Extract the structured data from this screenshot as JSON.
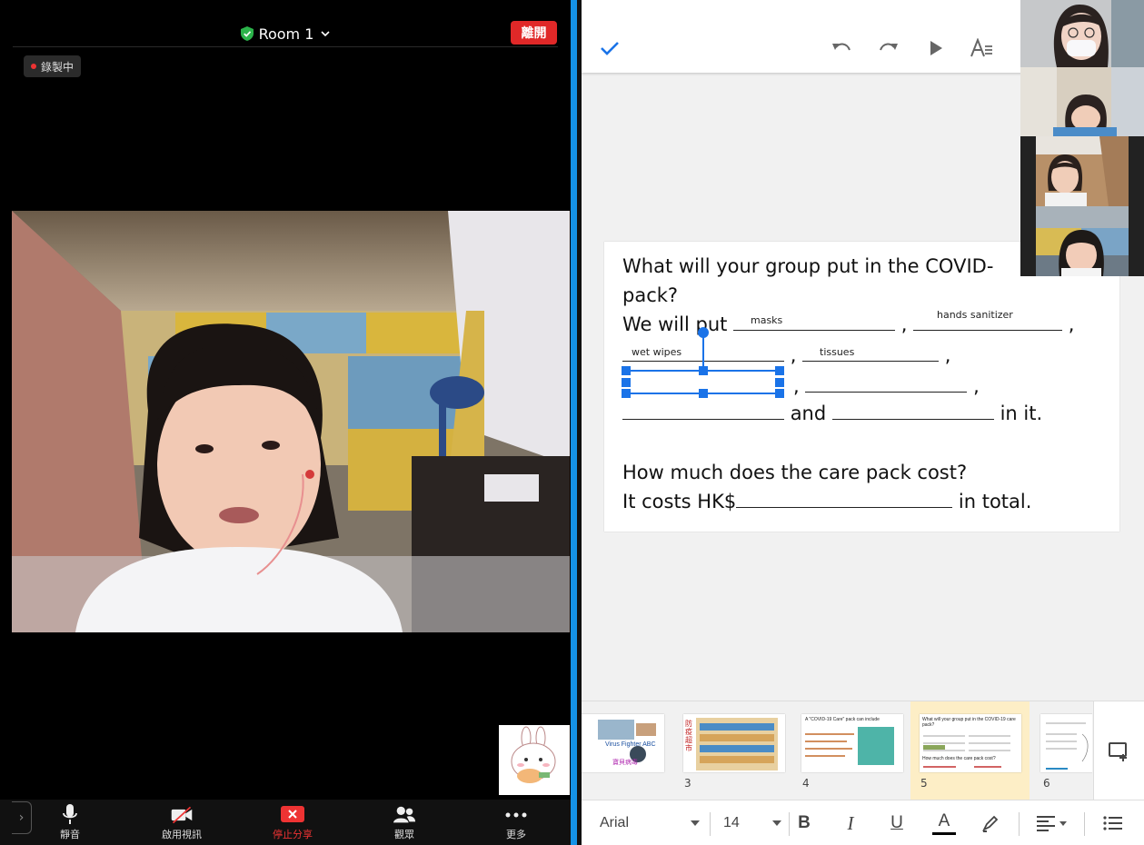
{
  "meeting": {
    "room_title": "Room 1",
    "leave_label": "離開",
    "recording_label": "錄製中",
    "toolbar": {
      "mute_label": "靜音",
      "video_label": "啟用視訊",
      "stop_share_label": "停止分享",
      "participants_label": "觀眾",
      "more_label": "更多"
    },
    "icons": {
      "room": "shield-check-icon",
      "chevron": "chevron-down-icon",
      "mute": "microphone-icon",
      "video": "video-off-icon",
      "share": "stop-share-icon",
      "participants": "people-icon",
      "more": "ellipsis-icon"
    }
  },
  "editor": {
    "topbar_icons": [
      "checkmark-icon",
      "undo-icon",
      "redo-icon",
      "play-icon",
      "text-format-icon"
    ],
    "slide": {
      "line1": "What will your group put in the COVID-",
      "line2": "pack?",
      "line3_prefix": "We will put",
      "line5_and": "and",
      "line5_suffix": "in it.",
      "line6": "How much does the care pack cost?",
      "line7_prefix": "It costs HK$",
      "line7_suffix": "in total.",
      "labels": {
        "masks": "masks",
        "hands_sanitizer": "hands sanitizer",
        "wet_wipes": "wet wipes",
        "tissues": "tissues"
      },
      "comma": ","
    },
    "filmstrip": {
      "slides": [
        {
          "number": "",
          "label_a": "Virus Fighter ABC",
          "label_b": "寶貝病毒"
        },
        {
          "number": "3",
          "label_a": "防疫超市",
          "label_b": ""
        },
        {
          "number": "4",
          "label_a": "A \"COVID-19 Care\" pack can include",
          "label_b": ""
        },
        {
          "number": "5",
          "label_a": "What will your group put in the COVID-19 care pack?",
          "label_b": "How much does the care pack cost?"
        },
        {
          "number": "6",
          "label_a": "",
          "label_b": ""
        }
      ],
      "selected_number": "5"
    },
    "format": {
      "font_name": "Arial",
      "font_size": "14",
      "bold_label": "B",
      "italic_label": "I",
      "underline_label": "U",
      "text_color_label": "A",
      "text_color": "#000000"
    }
  },
  "colors": {
    "accent_blue": "#1a73e8",
    "split_bar": "#1592e6",
    "leave_red": "#e02828",
    "selected_slide": "#fdeec6"
  }
}
